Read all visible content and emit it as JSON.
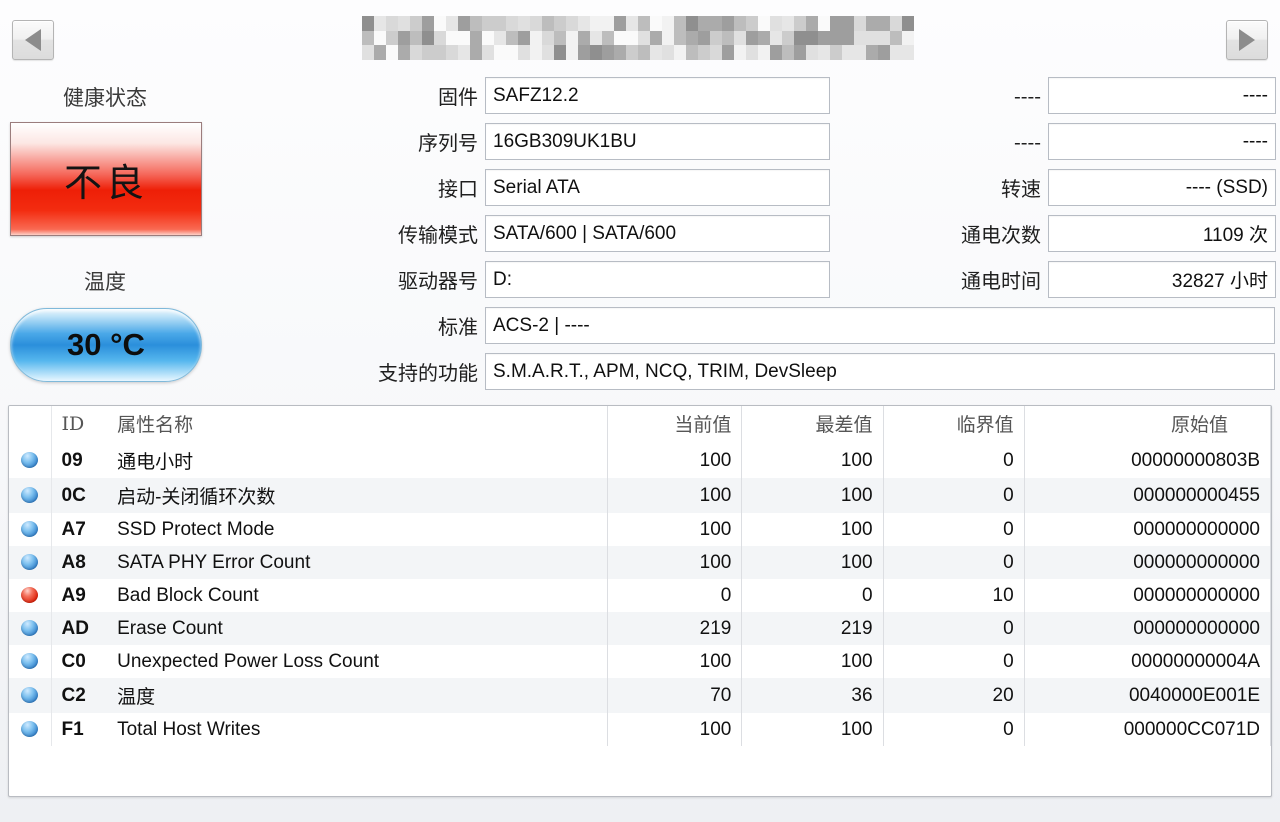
{
  "nav": {
    "prev_label": "◀",
    "next_label": "▶"
  },
  "titlebar": {
    "censored": true,
    "note": ""
  },
  "health": {
    "caption": "健康状态",
    "status": "不良",
    "status_color": "#ee1f07"
  },
  "temperature": {
    "caption": "温度",
    "value": "30 °C",
    "color": "#2b8fdb"
  },
  "info": {
    "center": [
      {
        "label": "固件",
        "value": "SAFZ12.2"
      },
      {
        "label": "序列号",
        "value": "16GB309UK1BU"
      },
      {
        "label": "接口",
        "value": "Serial ATA"
      },
      {
        "label": "传输模式",
        "value": "SATA/600 | SATA/600"
      },
      {
        "label": "驱动器号",
        "value": "D:"
      }
    ],
    "center_wide": [
      {
        "label": "标准",
        "value": "ACS-2 | ----"
      },
      {
        "label": "支持的功能",
        "value": "S.M.A.R.T., APM, NCQ, TRIM, DevSleep"
      }
    ],
    "right": [
      {
        "label": "----",
        "value": "----"
      },
      {
        "label": "----",
        "value": "----"
      },
      {
        "label": "转速",
        "value": "---- (SSD)"
      },
      {
        "label": "通电次数",
        "value": "1109 次"
      },
      {
        "label": "通电时间",
        "value": "32827 小时"
      }
    ]
  },
  "attributes": {
    "columns": {
      "id": "ID",
      "name": "属性名称",
      "current": "当前值",
      "worst": "最差值",
      "threshold": "临界值",
      "raw": "原始值"
    },
    "rows": [
      {
        "status": "blue",
        "id": "09",
        "name": "通电小时",
        "current": "100",
        "worst": "100",
        "threshold": "0",
        "raw": "00000000803B"
      },
      {
        "status": "blue",
        "id": "0C",
        "name": "启动-关闭循环次数",
        "current": "100",
        "worst": "100",
        "threshold": "0",
        "raw": "000000000455"
      },
      {
        "status": "blue",
        "id": "A7",
        "name": "SSD Protect Mode",
        "current": "100",
        "worst": "100",
        "threshold": "0",
        "raw": "000000000000"
      },
      {
        "status": "blue",
        "id": "A8",
        "name": "SATA PHY Error Count",
        "current": "100",
        "worst": "100",
        "threshold": "0",
        "raw": "000000000000"
      },
      {
        "status": "red",
        "id": "A9",
        "name": "Bad Block Count",
        "current": "0",
        "worst": "0",
        "threshold": "10",
        "raw": "000000000000"
      },
      {
        "status": "blue",
        "id": "AD",
        "name": "Erase Count",
        "current": "219",
        "worst": "219",
        "threshold": "0",
        "raw": "000000000000"
      },
      {
        "status": "blue",
        "id": "C0",
        "name": "Unexpected Power Loss Count",
        "current": "100",
        "worst": "100",
        "threshold": "0",
        "raw": "00000000004A"
      },
      {
        "status": "blue",
        "id": "C2",
        "name": "温度",
        "current": "70",
        "worst": "36",
        "threshold": "20",
        "raw": "0040000E001E"
      },
      {
        "status": "blue",
        "id": "F1",
        "name": "Total Host Writes",
        "current": "100",
        "worst": "100",
        "threshold": "0",
        "raw": "000000CC071D"
      }
    ]
  }
}
